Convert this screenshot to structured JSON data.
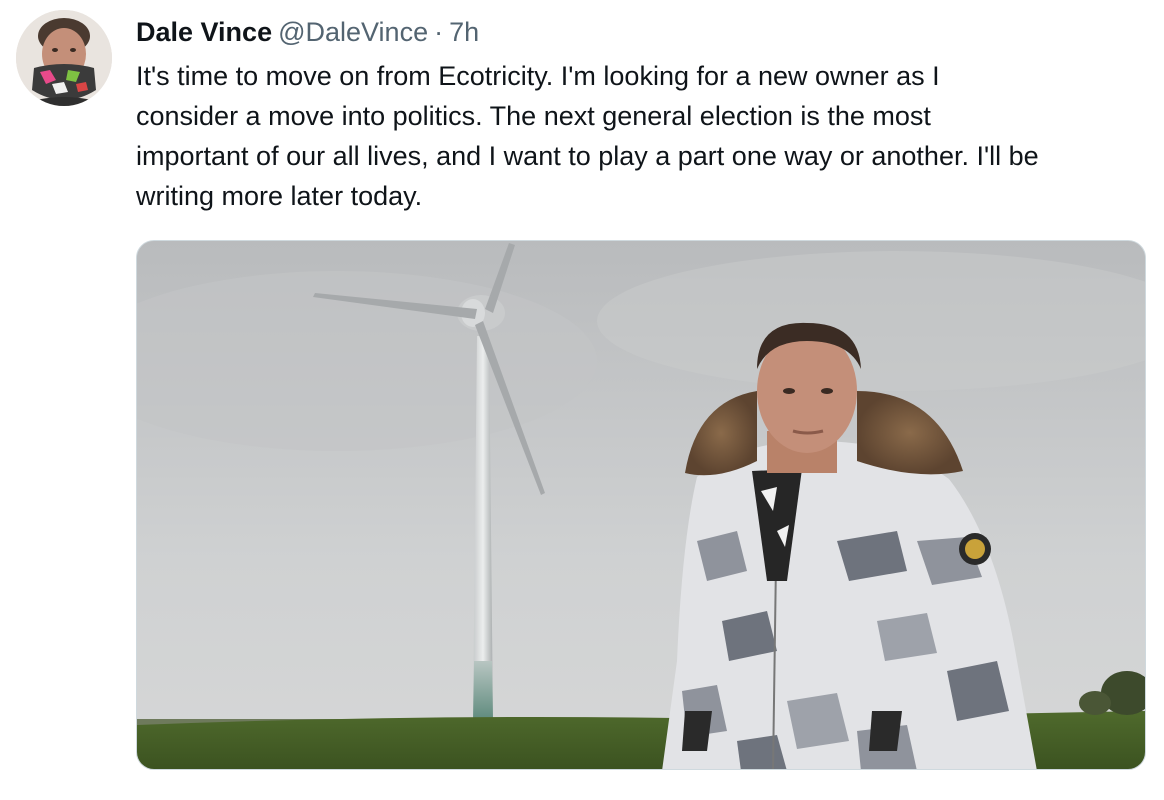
{
  "tweet": {
    "display_name": "Dale Vince",
    "handle": "@DaleVince",
    "separator": "·",
    "time": "7h",
    "text": "It's time to move on from Ecotricity.  I'm looking for a new owner as I\nconsider a move into politics. The next general election is the most\nimportant of our all lives, and I want to play a part one way or another. I'll be\nwriting more later today."
  },
  "colors": {
    "text_primary": "#0f1419",
    "text_secondary": "#536471",
    "media_border": "#cfd9de"
  }
}
